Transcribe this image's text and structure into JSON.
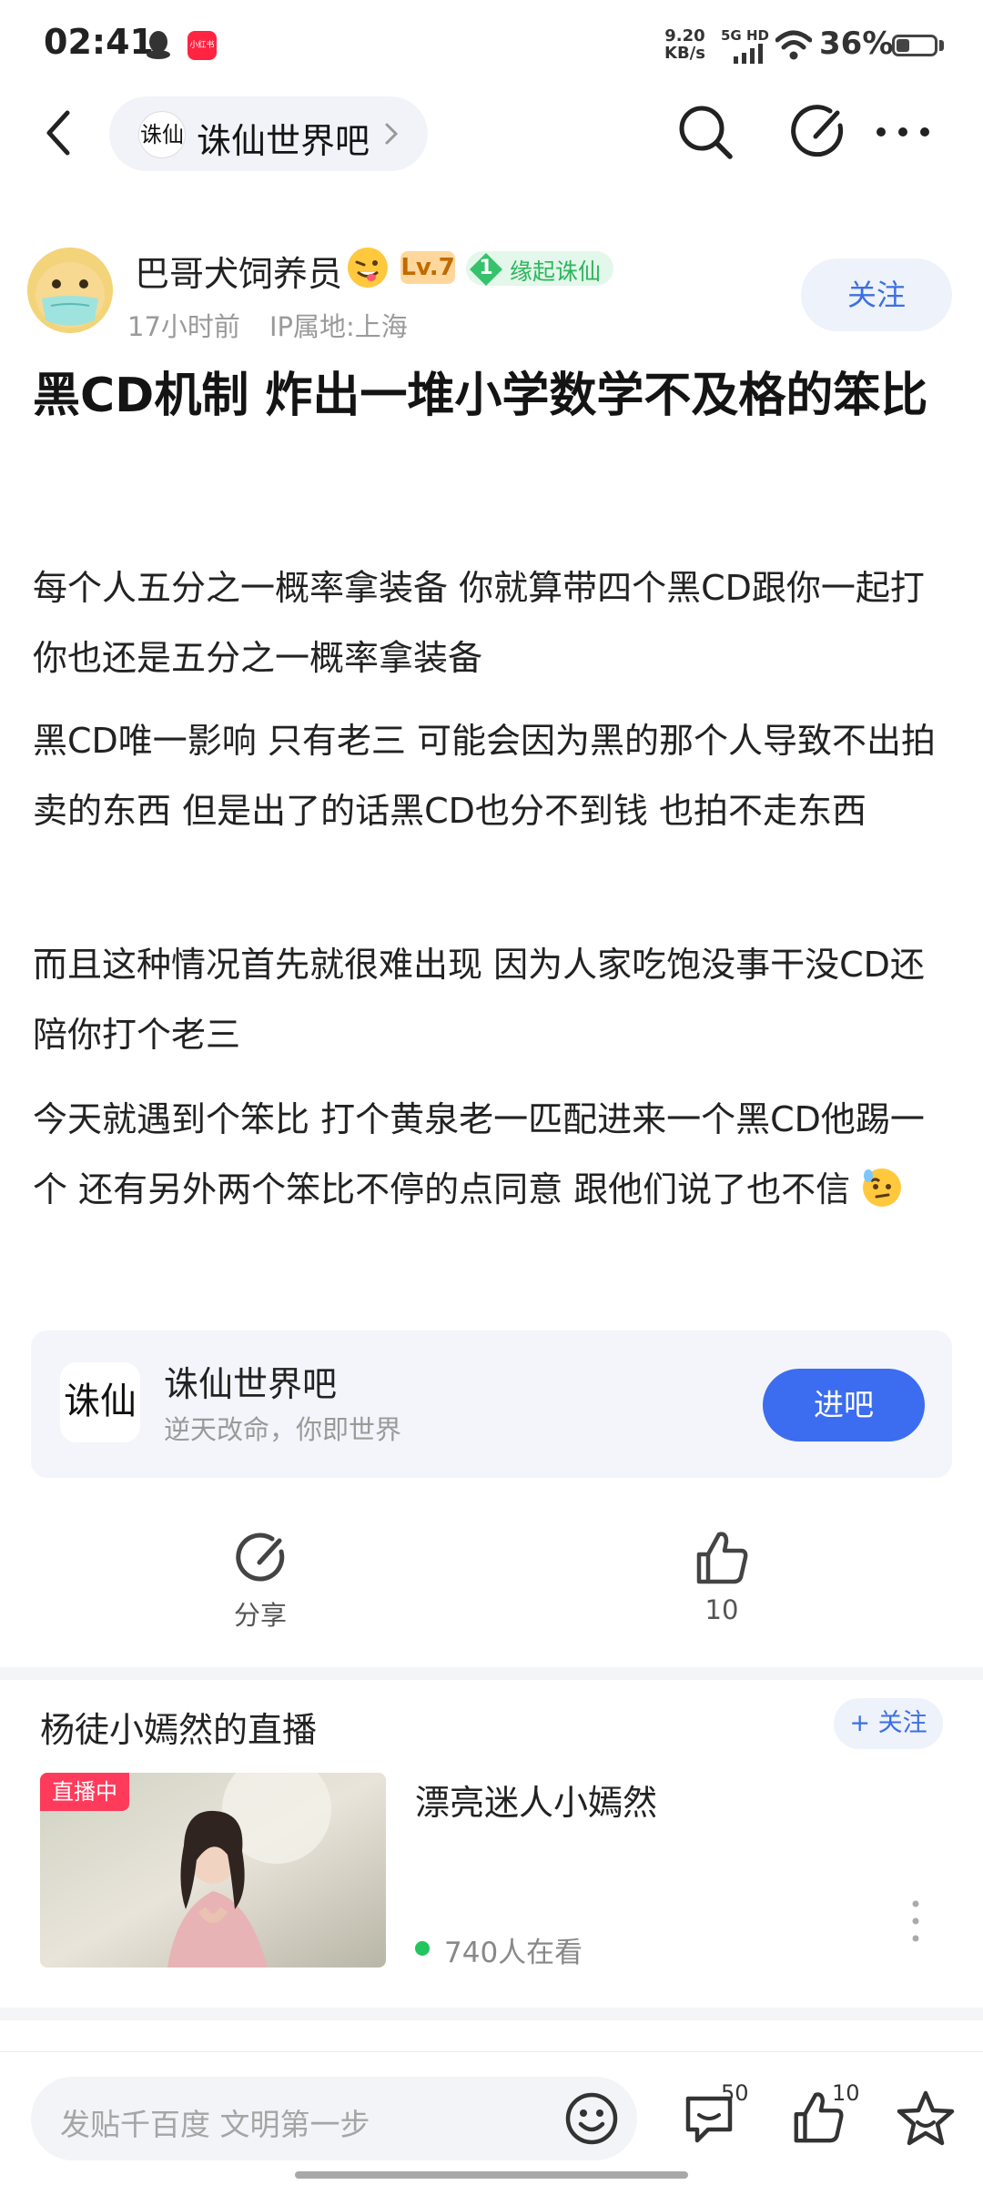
{
  "status_bar": {
    "time": "02:41",
    "net_speed_value": "9.20",
    "net_speed_unit": "KB/s",
    "network": "5G HD",
    "battery_pct": "36%",
    "battery_level": 0.36,
    "notification_app_label": "小红书"
  },
  "nav": {
    "forum_logo_text": "诛仙",
    "forum_name": "诛仙世界吧"
  },
  "post": {
    "author": "巴哥犬饲养员",
    "level": "Lv.7",
    "fan_level": "1",
    "fan_badge": "缘起诛仙",
    "time_ago": "17小时前",
    "ip_location": "IP属地:上海",
    "follow_label": "关注",
    "title": "黑CD机制 炸出一堆小学数学不及格的笨比",
    "paragraphs": [
      "每个人五分之一概率拿装备 你就算带四个黑CD跟你一起打你也还是五分之一概率拿装备",
      "黑CD唯一影响 只有老三 可能会因为黑的那个人导致不出拍卖的东西 但是出了的话黑CD也分不到钱 也拍不走东西",
      "而且这种情况首先就很难出现 因为人家吃饱没事干没CD还陪你打个老三",
      "今天就遇到个笨比 打个黄泉老一匹配进来一个黑CD他踢一个 还有另外两个笨比不停的点同意 跟他们说了也不信"
    ]
  },
  "forum_card": {
    "logo_text": "诛仙",
    "name": "诛仙世界吧",
    "slogan": "逆天改命，你即世界",
    "enter_label": "进吧"
  },
  "actions": {
    "share_label": "分享",
    "like_count": "10"
  },
  "live": {
    "section_title": "杨徒小嫣然的直播",
    "follow_label": "+ 关注",
    "tag": "直播中",
    "stream_title": "漂亮迷人小嫣然",
    "viewers": "740人在看"
  },
  "bottom_bar": {
    "placeholder": "发贴千百度 文明第一步",
    "comment_count": "50",
    "like_count": "10"
  },
  "colors": {
    "accent_blue": "#3c6df0",
    "link_blue": "#3b6fe6",
    "live_red": "#ff3b5c",
    "fan_green": "#2db55d",
    "level_orange": "#ffd79c"
  },
  "icons": [
    "qq-icon",
    "signal-icon",
    "wifi-icon",
    "battery-icon",
    "back-icon",
    "chevron-right-icon",
    "search-icon",
    "edit-icon",
    "more-icon",
    "emoji-face-icon",
    "diamond-icon",
    "share-icon",
    "thumbs-up-icon",
    "comment-icon",
    "smiley-icon",
    "star-icon",
    "more-vertical-icon",
    "thinking-face-icon"
  ]
}
